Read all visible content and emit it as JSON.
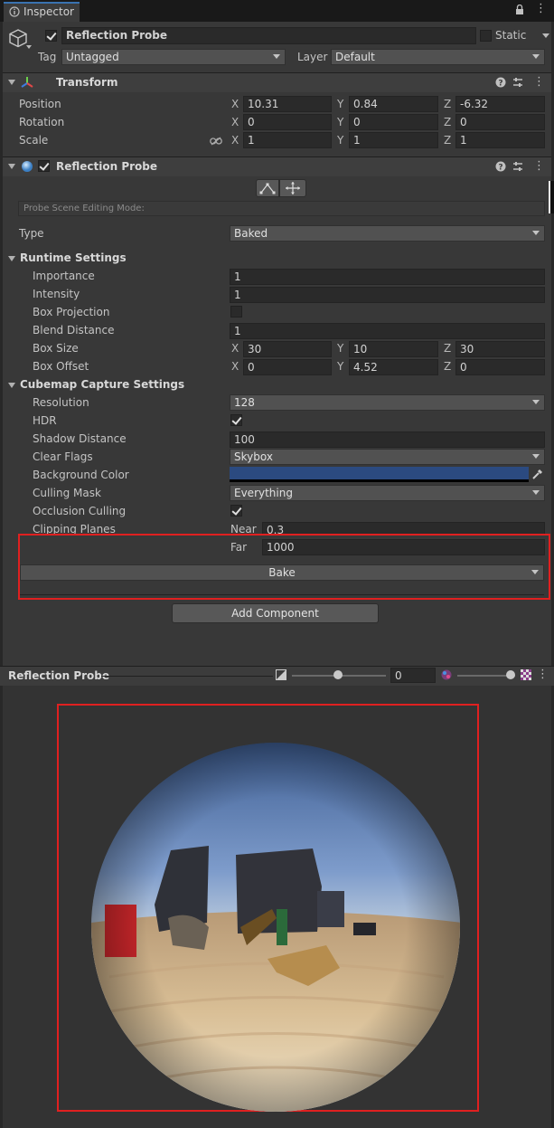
{
  "tab": {
    "title": "Inspector"
  },
  "gameobject": {
    "name": "Reflection Probe",
    "static_label": "Static",
    "tag_label": "Tag",
    "tag_value": "Untagged",
    "layer_label": "Layer",
    "layer_value": "Default"
  },
  "transform": {
    "title": "Transform",
    "position": {
      "label": "Position",
      "x": "10.31",
      "y": "0.84",
      "z": "-6.32"
    },
    "rotation": {
      "label": "Rotation",
      "x": "0",
      "y": "0",
      "z": "0"
    },
    "scale": {
      "label": "Scale",
      "x": "1",
      "y": "1",
      "z": "1"
    }
  },
  "axes": {
    "x": "X",
    "y": "Y",
    "z": "Z"
  },
  "probe": {
    "title": "Reflection Probe",
    "edit_mode_label": "Probe Scene Editing Mode:",
    "type_label": "Type",
    "type_value": "Baked",
    "runtime": {
      "title": "Runtime Settings",
      "importance_label": "Importance",
      "importance": "1",
      "intensity_label": "Intensity",
      "intensity": "1",
      "box_projection_label": "Box Projection",
      "blend_distance_label": "Blend Distance",
      "blend_distance": "1",
      "box_size_label": "Box Size",
      "box_size": {
        "x": "30",
        "y": "10",
        "z": "30"
      },
      "box_offset_label": "Box Offset",
      "box_offset": {
        "x": "0",
        "y": "4.52",
        "z": "0"
      }
    },
    "cubemap": {
      "title": "Cubemap Capture Settings",
      "resolution_label": "Resolution",
      "resolution": "128",
      "hdr_label": "HDR",
      "shadow_distance_label": "Shadow Distance",
      "shadow_distance": "100",
      "clear_flags_label": "Clear Flags",
      "clear_flags": "Skybox",
      "background_color_label": "Background Color",
      "background_color": "#2b4a80",
      "culling_mask_label": "Culling Mask",
      "culling_mask": "Everything",
      "occlusion_culling_label": "Occlusion Culling",
      "clipping_planes_label": "Clipping Planes",
      "near_label": "Near",
      "near": "0.3",
      "far_label": "Far",
      "far": "1000"
    },
    "bake_label": "Bake"
  },
  "add_component_label": "Add Component",
  "preview": {
    "title": "Reflection Probe",
    "exposure_value": "0"
  },
  "colors": {
    "highlight_red": "#e02020",
    "tab_accent": "#3a72b0"
  }
}
